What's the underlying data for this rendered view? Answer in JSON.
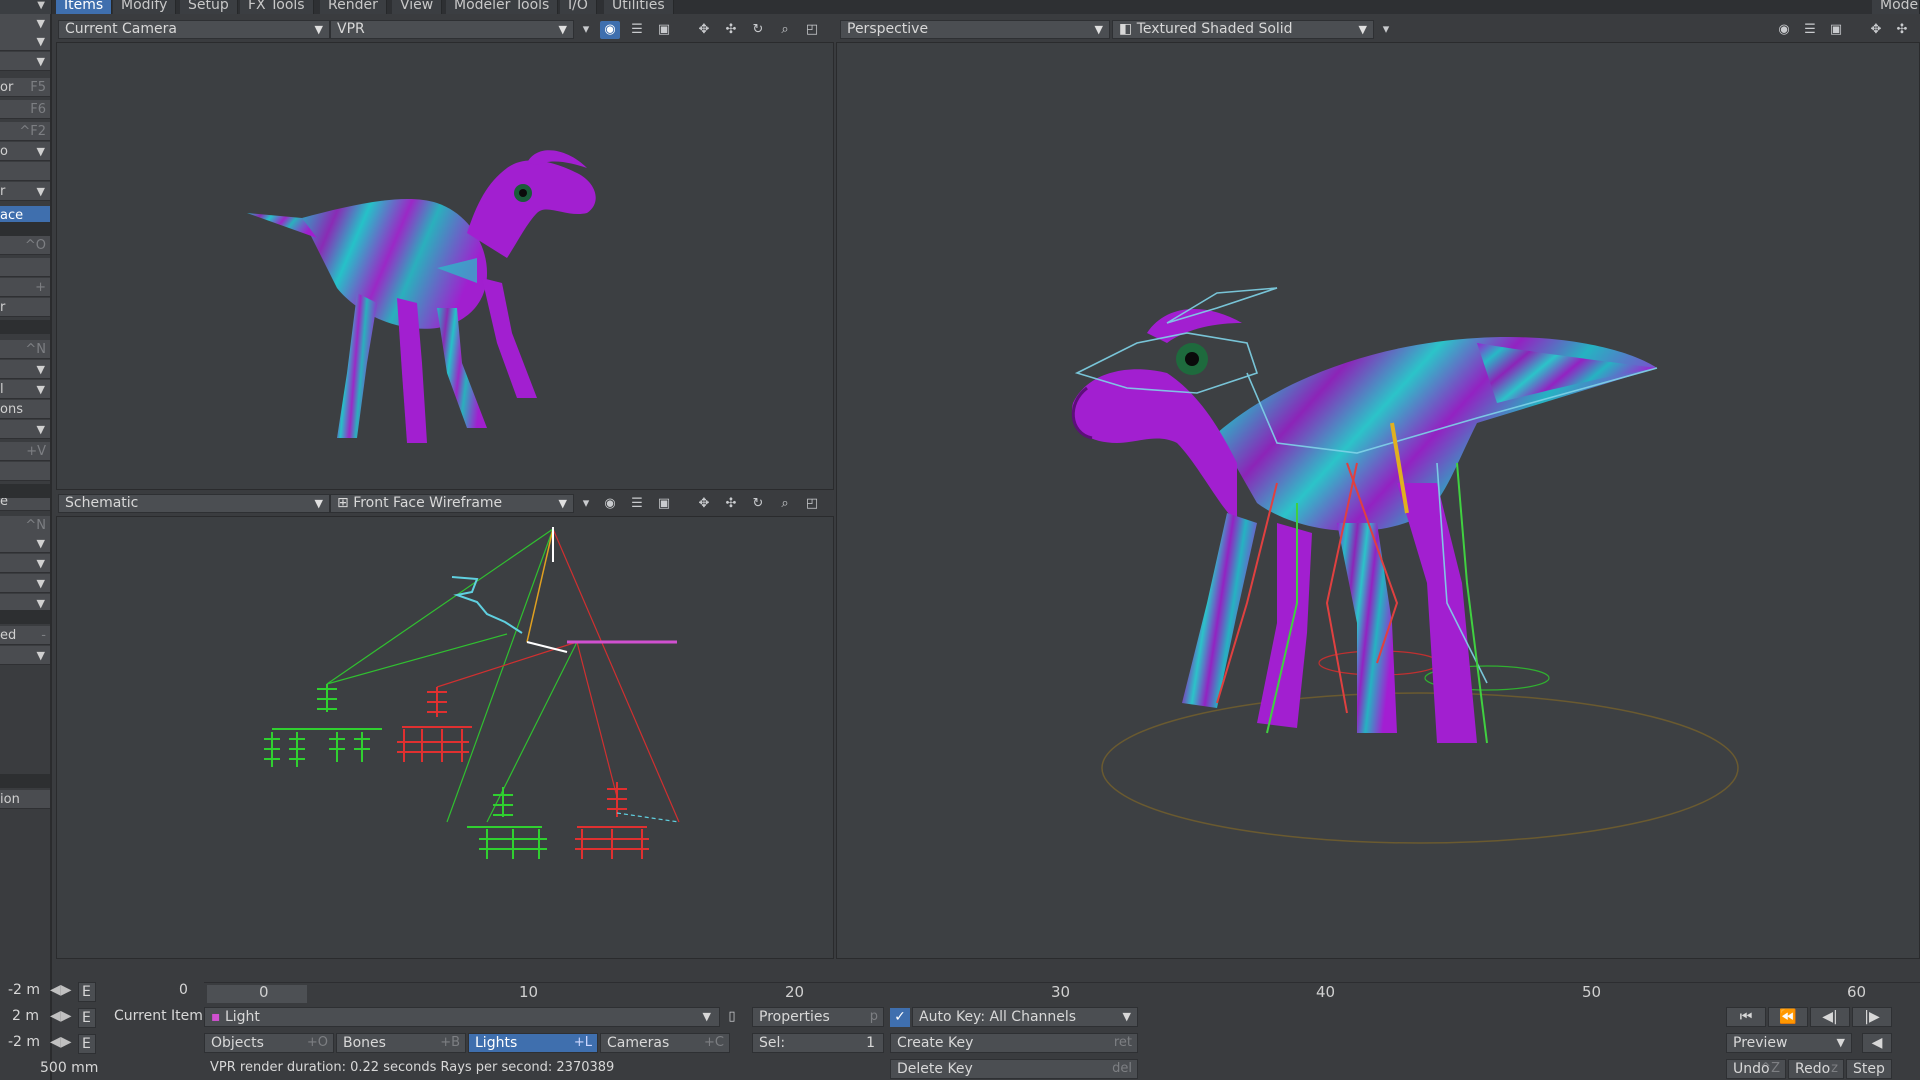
{
  "menu": {
    "tabs": [
      "Items",
      "Modify",
      "Setup",
      "FX Tools",
      "Render",
      "View",
      "Modeler Tools",
      "I/O",
      "Utilities"
    ],
    "active": "Items",
    "right_label": "Mode"
  },
  "left_panel": {
    "items": [
      {
        "label": "",
        "shortcut": "",
        "dropdown": true
      },
      {
        "label": "",
        "shortcut": "",
        "dropdown": true
      },
      {
        "label": "",
        "shortcut": "",
        "dropdown": true
      },
      {
        "label": "or",
        "shortcut": "F5"
      },
      {
        "label": "",
        "shortcut": "F6"
      },
      {
        "label": "",
        "shortcut": "^F2"
      },
      {
        "label": "o",
        "shortcut": "",
        "dropdown": true
      },
      {
        "label": "",
        "shortcut": ""
      },
      {
        "label": "r",
        "shortcut": "",
        "dropdown": true
      },
      {
        "label": "ace",
        "shortcut": "",
        "selected": true
      },
      {
        "label": "",
        "shortcut": "^O"
      },
      {
        "label": "",
        "shortcut": ""
      },
      {
        "label": "",
        "shortcut": "+"
      },
      {
        "label": "r",
        "shortcut": ""
      },
      {
        "label": "",
        "shortcut": "^N"
      },
      {
        "label": "",
        "shortcut": "",
        "dropdown": true
      },
      {
        "label": "l",
        "shortcut": "",
        "dropdown": true
      },
      {
        "label": "ons",
        "shortcut": ""
      },
      {
        "label": "",
        "shortcut": "",
        "dropdown": true
      },
      {
        "label": "",
        "shortcut": "+V"
      },
      {
        "label": "",
        "shortcut": ""
      },
      {
        "label": "e",
        "shortcut": ""
      },
      {
        "label": "",
        "shortcut": "^N"
      },
      {
        "label": "",
        "shortcut": "",
        "dropdown": true
      },
      {
        "label": "",
        "shortcut": "",
        "dropdown": true
      },
      {
        "label": "",
        "shortcut": "",
        "dropdown": true
      },
      {
        "label": "",
        "shortcut": "",
        "dropdown": true
      },
      {
        "label": "ed",
        "shortcut": "-"
      },
      {
        "label": "",
        "shortcut": "",
        "dropdown": true
      },
      {
        "label": "ion",
        "shortcut": ""
      }
    ]
  },
  "viewport_tl": {
    "camera": "Current Camera",
    "mode": "VPR"
  },
  "viewport_bl": {
    "view": "Schematic",
    "mode": "Front Face Wireframe"
  },
  "viewport_right": {
    "view": "Perspective",
    "mode": "Textured Shaded Solid"
  },
  "timeline": {
    "ruler": [
      "0",
      "10",
      "20",
      "30",
      "40",
      "50",
      "60"
    ],
    "current_frame": "0",
    "rows": [
      {
        "value": "-2 m"
      },
      {
        "value": "2 m"
      },
      {
        "value": "-2 m"
      }
    ],
    "grid_size": "500 mm",
    "e_label": "E",
    "current_item_label": "Current Item",
    "current_item_value": "Light",
    "properties_label": "Properties",
    "properties_shortcut": "p",
    "auto_key": "Auto Key: All Channels",
    "filters": [
      {
        "label": "Objects",
        "shortcut": "+O"
      },
      {
        "label": "Bones",
        "shortcut": "+B"
      },
      {
        "label": "Lights",
        "shortcut": "+L",
        "selected": true
      },
      {
        "label": "Cameras",
        "shortcut": "+C"
      }
    ],
    "sel_label": "Sel:",
    "sel_value": "1",
    "create_key": "Create Key",
    "create_key_shortcut": "ret",
    "delete_key": "Delete Key",
    "delete_key_shortcut": "del",
    "status": "VPR render duration: 0.22 seconds  Rays per second: 2370389",
    "preview": "Preview",
    "undo": "Undo",
    "undo_shortcut": "^Z",
    "redo": "Redo",
    "redo_shortcut": "z",
    "step": "Step"
  }
}
